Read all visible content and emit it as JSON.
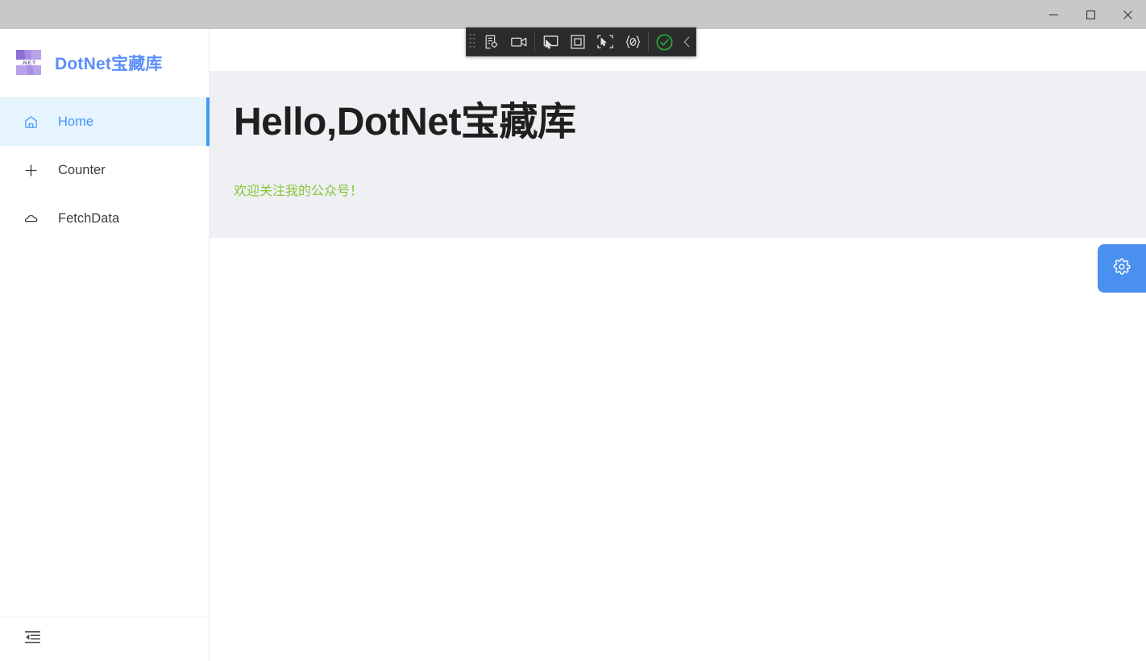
{
  "window": {
    "controls": [
      {
        "name": "minimize",
        "label": "Minimize",
        "glyph": "minimize-icon"
      },
      {
        "name": "maximize",
        "label": "Maximize",
        "glyph": "maximize-icon"
      },
      {
        "name": "close",
        "label": "Close",
        "glyph": "close-icon"
      }
    ],
    "titlebar_color": "#c8c8c8"
  },
  "sidebar": {
    "brand": {
      "title": "DotNet宝藏库",
      "logo_icon": "dotnet-logo-icon",
      "logo_text": ".NET",
      "title_color": "#5b8ff9"
    },
    "items": [
      {
        "label": "Home",
        "icon": "home-icon",
        "active": true
      },
      {
        "label": "Counter",
        "icon": "plus-icon",
        "active": false
      },
      {
        "label": "FetchData",
        "icon": "cloud-icon",
        "active": false
      }
    ],
    "active_bg": "#e6f4fe",
    "active_accent": "#4096ff",
    "footer": {
      "collapse_icon": "menu-fold-icon",
      "collapse_label": "Collapse sidebar"
    }
  },
  "main": {
    "hero": {
      "title": "Hello,DotNet宝藏库",
      "subtitle": "欢迎关注我的公众号！",
      "subtitle_color": "#86c53a",
      "background": "#eff0f4"
    },
    "settings_fab": {
      "icon": "gear-icon",
      "label": "Settings",
      "color": "#4a90f0"
    }
  },
  "recorder_toolbar": {
    "background": "#2b2b2b",
    "buttons": [
      {
        "name": "drag-handle",
        "icon": "drag-dots-icon",
        "label": "Drag"
      },
      {
        "name": "record-settings",
        "icon": "record-target-icon",
        "label": "Record settings"
      },
      {
        "name": "record",
        "icon": "video-camera-icon",
        "label": "Record"
      },
      {
        "name": "select-element",
        "icon": "cursor-select-icon",
        "label": "Select element"
      },
      {
        "name": "highlight-box",
        "icon": "square-outline-icon",
        "label": "Highlight box"
      },
      {
        "name": "pick-region",
        "icon": "region-select-icon",
        "label": "Pick region"
      },
      {
        "name": "inspect-code",
        "icon": "code-brackets-icon",
        "label": "Inspect code"
      },
      {
        "name": "confirm",
        "icon": "check-circle-icon",
        "label": "Confirm"
      },
      {
        "name": "collapse-toolbar",
        "icon": "chevron-left-icon",
        "label": "Collapse toolbar"
      }
    ]
  }
}
